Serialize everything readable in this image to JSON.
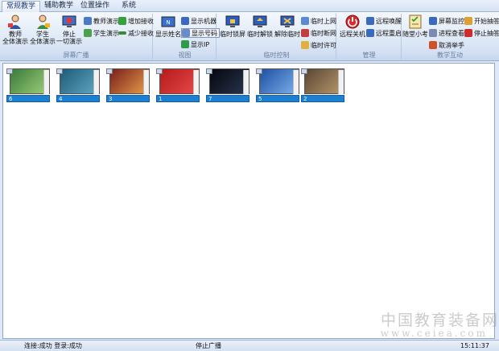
{
  "menu": {
    "tabs": [
      "常规教学",
      "辅助教学",
      "位置操作",
      "系统"
    ]
  },
  "ribbon": {
    "screen_broadcast": {
      "label": "屏幕广播",
      "teacher_demo": "教师\n全体演示",
      "student_demo": "学生\n全体演示",
      "stop_all": "停止\n一切演示",
      "teacher_show": "教师演示",
      "student_show": "学生演示",
      "add_receive": "增加接收",
      "reduce_receive": "减少接收"
    },
    "view": {
      "label": "视图",
      "show_name": "显示姓名",
      "show_machine": "显示机器",
      "show_number": "显示号码",
      "show_ip": "显示IP"
    },
    "temp_control": {
      "label": "临时控制",
      "temp_lock": "临时锁屏",
      "temp_unlock": "临时解锁",
      "cancel_temp": "解除临时",
      "temp_online": "临时上网",
      "temp_offline": "临时断网",
      "temp_allow": "临时许可"
    },
    "manage": {
      "label": "管理",
      "remote_shutdown": "远程关机",
      "remote_wake": "远程唤醒",
      "remote_restart": "远程重启"
    },
    "interact": {
      "label": "教学互动",
      "quiz": "随堂小考",
      "screen_monitor": "屏幕监控",
      "process_view": "进程查看",
      "cancel_hand": "取消举手",
      "start_roll": "开始抽答",
      "stop_roll": "停止抽答"
    }
  },
  "thumbnails": [
    {
      "label": "6",
      "colors": [
        "#3a7a3a",
        "#9fd07a"
      ]
    },
    {
      "label": "4",
      "colors": [
        "#1f5a78",
        "#5fa9c4"
      ]
    },
    {
      "label": "3",
      "colors": [
        "#7a1c1c",
        "#e8a24a"
      ]
    },
    {
      "label": "1",
      "colors": [
        "#b31b1b",
        "#e84a4a"
      ]
    },
    {
      "label": "7",
      "colors": [
        "#05070d",
        "#2a3552"
      ]
    },
    {
      "label": "5",
      "colors": [
        "#1f4fa3",
        "#7bb3ea"
      ]
    },
    {
      "label": "2",
      "colors": [
        "#5a4632",
        "#b89a6e"
      ]
    }
  ],
  "status": {
    "left": "连接:成功  登录:成功",
    "center": "停止广播",
    "time": "15:11:37"
  },
  "watermark": {
    "line1": "中国教育装备网",
    "line2": "www.ceiea.com"
  }
}
